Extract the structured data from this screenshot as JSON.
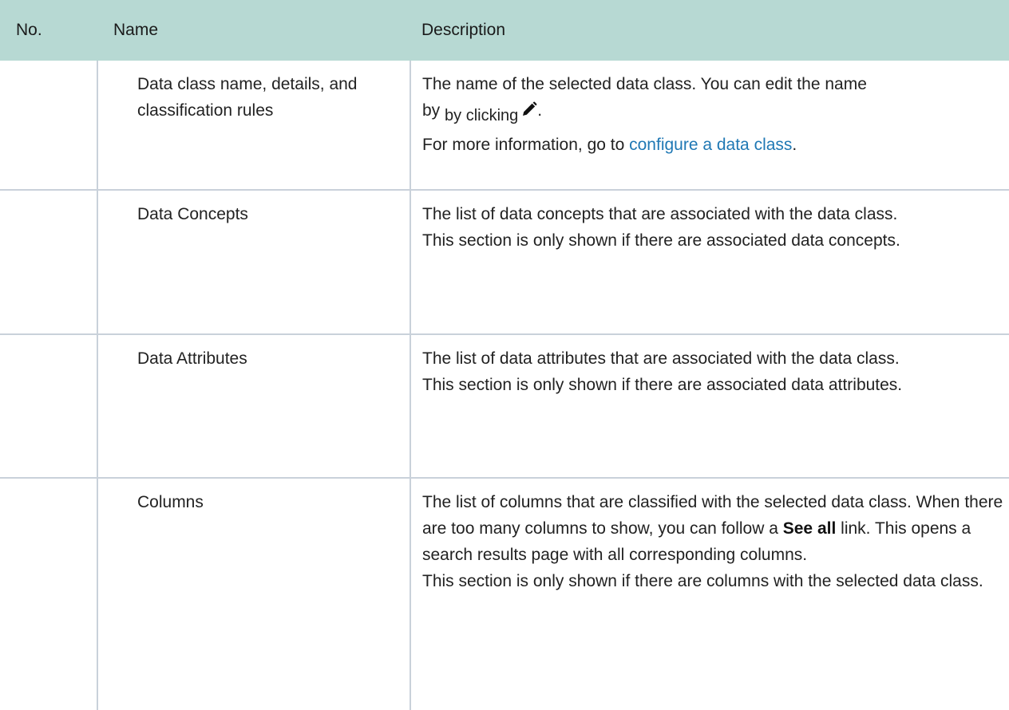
{
  "table": {
    "headers": {
      "no": "No.",
      "name": "Name",
      "description": "Description"
    },
    "rows": [
      {
        "no": "",
        "name": "Data class name, details, and classification rules",
        "desc": {
          "line1": "The name of the selected data class. You can edit the name",
          "line2_prefix": "by",
          "line2_suffix": "by clicking",
          "line2_end": ".",
          "line3_prefix": "For more information, go to",
          "link": "configure a data class",
          "line3_suffix": "."
        }
      },
      {
        "no": "",
        "name": "Data Concepts",
        "desc": {
          "p1": "The list of data concepts that are associated with the data class.",
          "p2": "This section is only shown if there are associated data concepts."
        }
      },
      {
        "no": "",
        "name": "Data Attributes",
        "desc": {
          "p1": "The list of data attributes that are associated with the data class.",
          "p2": "This section is only shown if there are associated data attributes."
        }
      },
      {
        "no": "",
        "name": "Columns",
        "desc": {
          "p1_before": "The list of columns that are classified with the selected data class. When there are too many columns to show, you can follow a",
          "p1_bold": "See all",
          "p1_after": "link. This opens a search results page with all corresponding columns.",
          "p2": "This section is only shown if there are columns with the selected data class."
        }
      }
    ]
  },
  "icons": {
    "edit": "pencil-icon"
  },
  "colors": {
    "header_bg": "#b7d9d3",
    "link": "#1f78b4",
    "border": "#c9d1da"
  }
}
